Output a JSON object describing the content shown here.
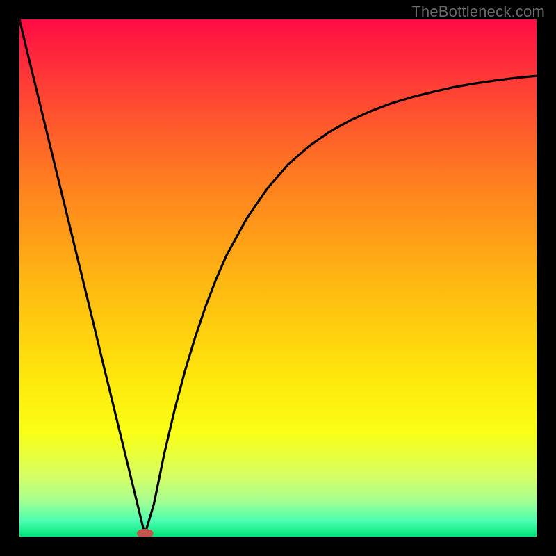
{
  "watermark": "TheBottleneck.com",
  "chart_data": {
    "type": "line",
    "title": "",
    "xlabel": "",
    "ylabel": "",
    "xlim": [
      0,
      100
    ],
    "ylim": [
      0,
      100
    ],
    "grid": false,
    "legend": false,
    "background_gradient": {
      "stops": [
        {
          "offset": 0.0,
          "color": "#ff0b44"
        },
        {
          "offset": 0.12,
          "color": "#ff3b36"
        },
        {
          "offset": 0.3,
          "color": "#ff7a21"
        },
        {
          "offset": 0.5,
          "color": "#ffb512"
        },
        {
          "offset": 0.68,
          "color": "#ffe40b"
        },
        {
          "offset": 0.8,
          "color": "#f9ff15"
        },
        {
          "offset": 0.88,
          "color": "#d8ff60"
        },
        {
          "offset": 0.93,
          "color": "#a8ff90"
        },
        {
          "offset": 0.97,
          "color": "#4bffb0"
        },
        {
          "offset": 1.0,
          "color": "#00e57a"
        }
      ]
    },
    "marker": {
      "x": 24.3,
      "y": 0.6,
      "color": "#c1554b",
      "rx": 1.6,
      "ry": 0.9
    },
    "series": [
      {
        "name": "curve",
        "color": "#000000",
        "x": [
          0,
          2,
          4,
          6,
          8,
          10,
          12,
          14,
          16,
          18,
          20,
          22,
          24,
          24.3,
          26,
          28,
          30,
          32,
          34,
          36,
          38,
          40,
          44,
          48,
          52,
          56,
          60,
          64,
          68,
          72,
          76,
          80,
          84,
          88,
          92,
          96,
          100
        ],
        "y": [
          100,
          91.7,
          83.5,
          75.3,
          67.1,
          58.9,
          50.7,
          42.5,
          34.2,
          26.0,
          17.8,
          9.6,
          1.4,
          0.6,
          6.3,
          16.0,
          24.5,
          32.0,
          38.6,
          44.5,
          49.7,
          54.3,
          61.6,
          67.4,
          72.0,
          75.5,
          78.3,
          80.5,
          82.3,
          83.8,
          85.0,
          86.0,
          86.9,
          87.6,
          88.2,
          88.7,
          89.1
        ]
      }
    ]
  }
}
